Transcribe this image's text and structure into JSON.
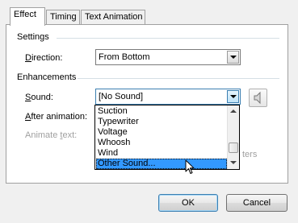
{
  "tabs": [
    {
      "label": "Effect",
      "active": true
    },
    {
      "label": "Timing",
      "active": false
    },
    {
      "label": "Text Animation",
      "active": false
    }
  ],
  "settings": {
    "group_label": "Settings",
    "direction_label": "Direction:",
    "direction_value": "From Bottom"
  },
  "enhancements": {
    "group_label": "Enhancements",
    "sound_label": "Sound:",
    "sound_value": "[No Sound]",
    "after_animation_label": "After animation:",
    "animate_text_label": "Animate text:",
    "partial_hidden_text": "ters"
  },
  "sound_list": {
    "items": [
      "Suction",
      "Typewriter",
      "Voltage",
      "Whoosh",
      "Wind",
      "Other Sound..."
    ],
    "selected_index": 5,
    "scroll_position": 0.95
  },
  "buttons": {
    "ok": "OK",
    "cancel": "Cancel"
  },
  "icons": {
    "speaker": "speaker-icon",
    "pointer": "mouse-pointer-icon"
  },
  "colors": {
    "selection": "#3399ff",
    "panel_bg": "#ffffff",
    "dialog_bg": "#f0f0f0"
  }
}
